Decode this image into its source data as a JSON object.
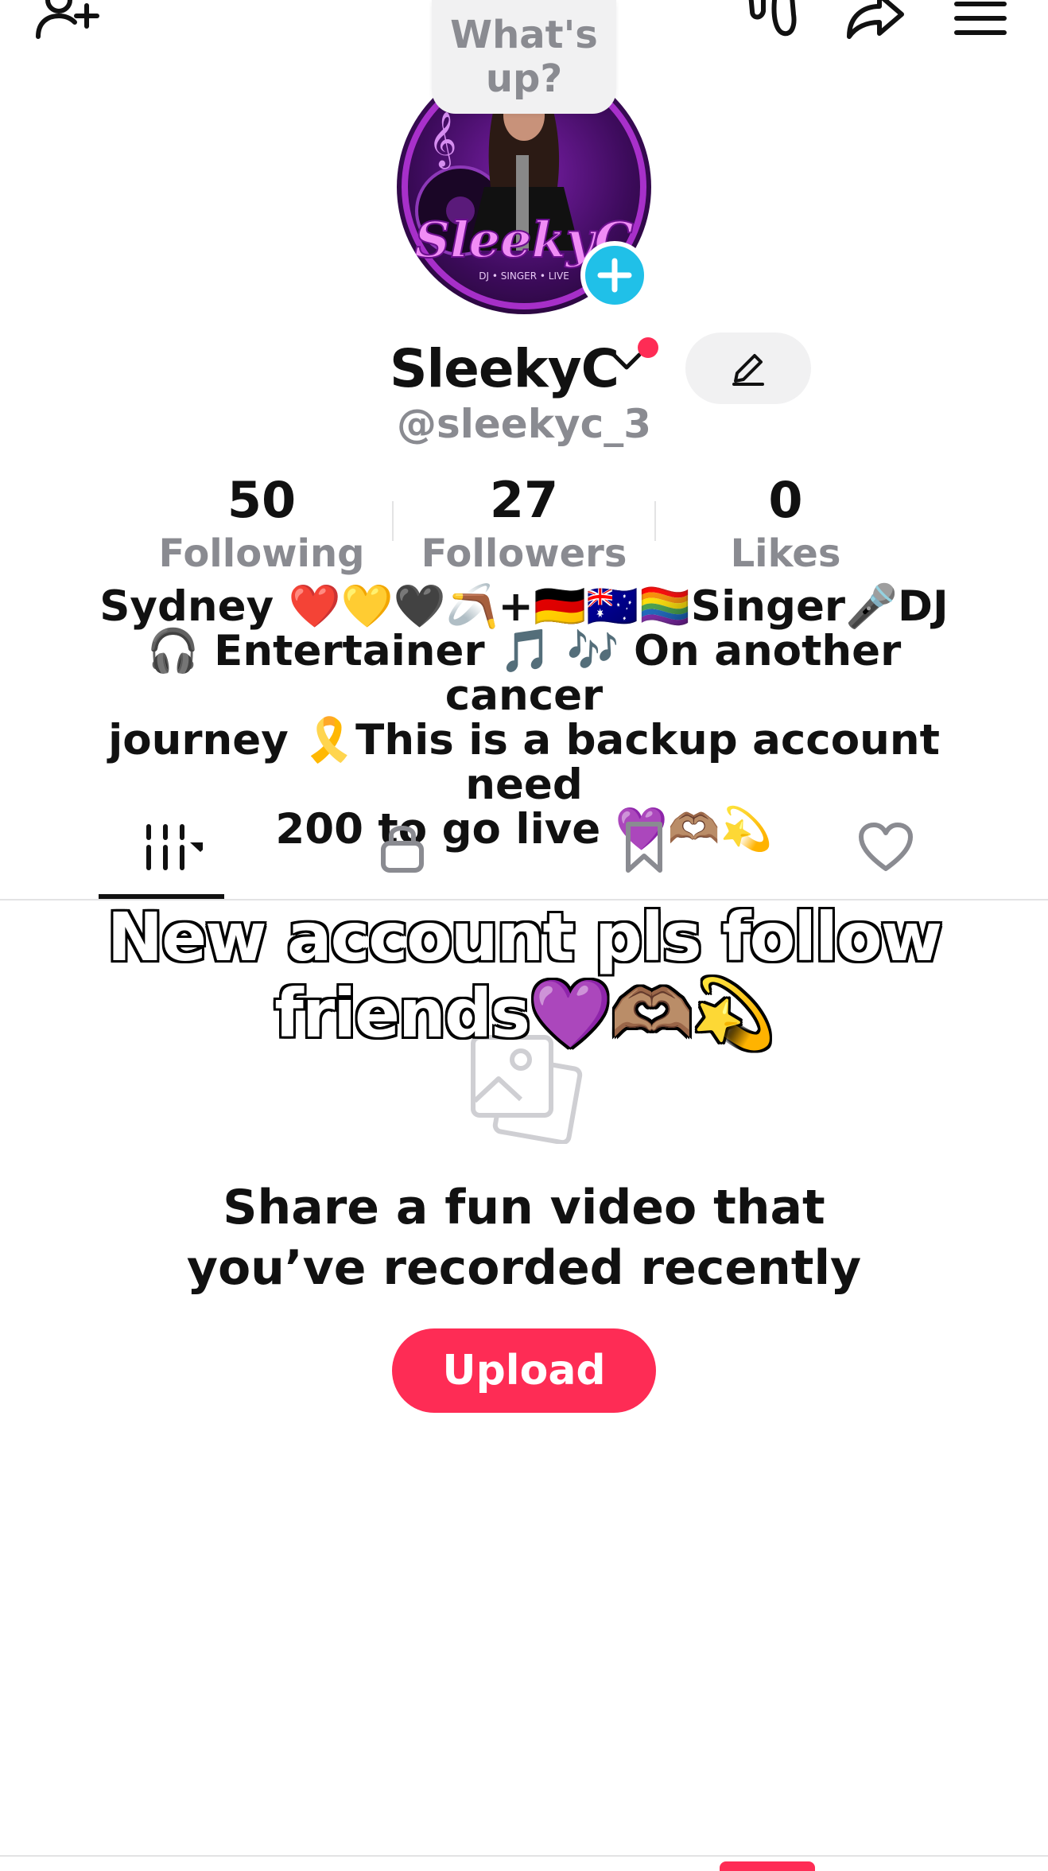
{
  "header": {
    "status_bubble": "What's\nup?",
    "icons": [
      "add-friend-icon",
      "footprints-icon",
      "share-icon",
      "menu-icon"
    ]
  },
  "profile": {
    "display_name": "SleekyC",
    "username": "@sleekyc_3",
    "stats": [
      {
        "value": "50",
        "label": "Following"
      },
      {
        "value": "27",
        "label": "Followers"
      },
      {
        "value": "0",
        "label": "Likes"
      }
    ],
    "bio": "Sydney ❤️💛🖤🪃+🇩🇪🇦🇺🏳️‍🌈Singer🎤DJ\n🎧 Entertainer 🎵 🎶 On another cancer\njourney 🎗️This is a backup account need\n200 to go live 💜🫶🏽💫"
  },
  "tabs": [
    {
      "name": "videos-grid",
      "active": true
    },
    {
      "name": "private",
      "active": false
    },
    {
      "name": "saved",
      "active": false
    },
    {
      "name": "liked",
      "active": false
    }
  ],
  "overlay_caption": "New account pls follow\nfriends💜🫶🏽💫",
  "empty_state": {
    "title": "Share a fun video that\nyou’ve recorded recently",
    "upload_label": "Upload"
  },
  "colors": {
    "accent": "#fe2c55",
    "plus_badge": "#20c0e8",
    "muted_text": "#8a8b91",
    "chip_bg": "#f1f1f2"
  }
}
